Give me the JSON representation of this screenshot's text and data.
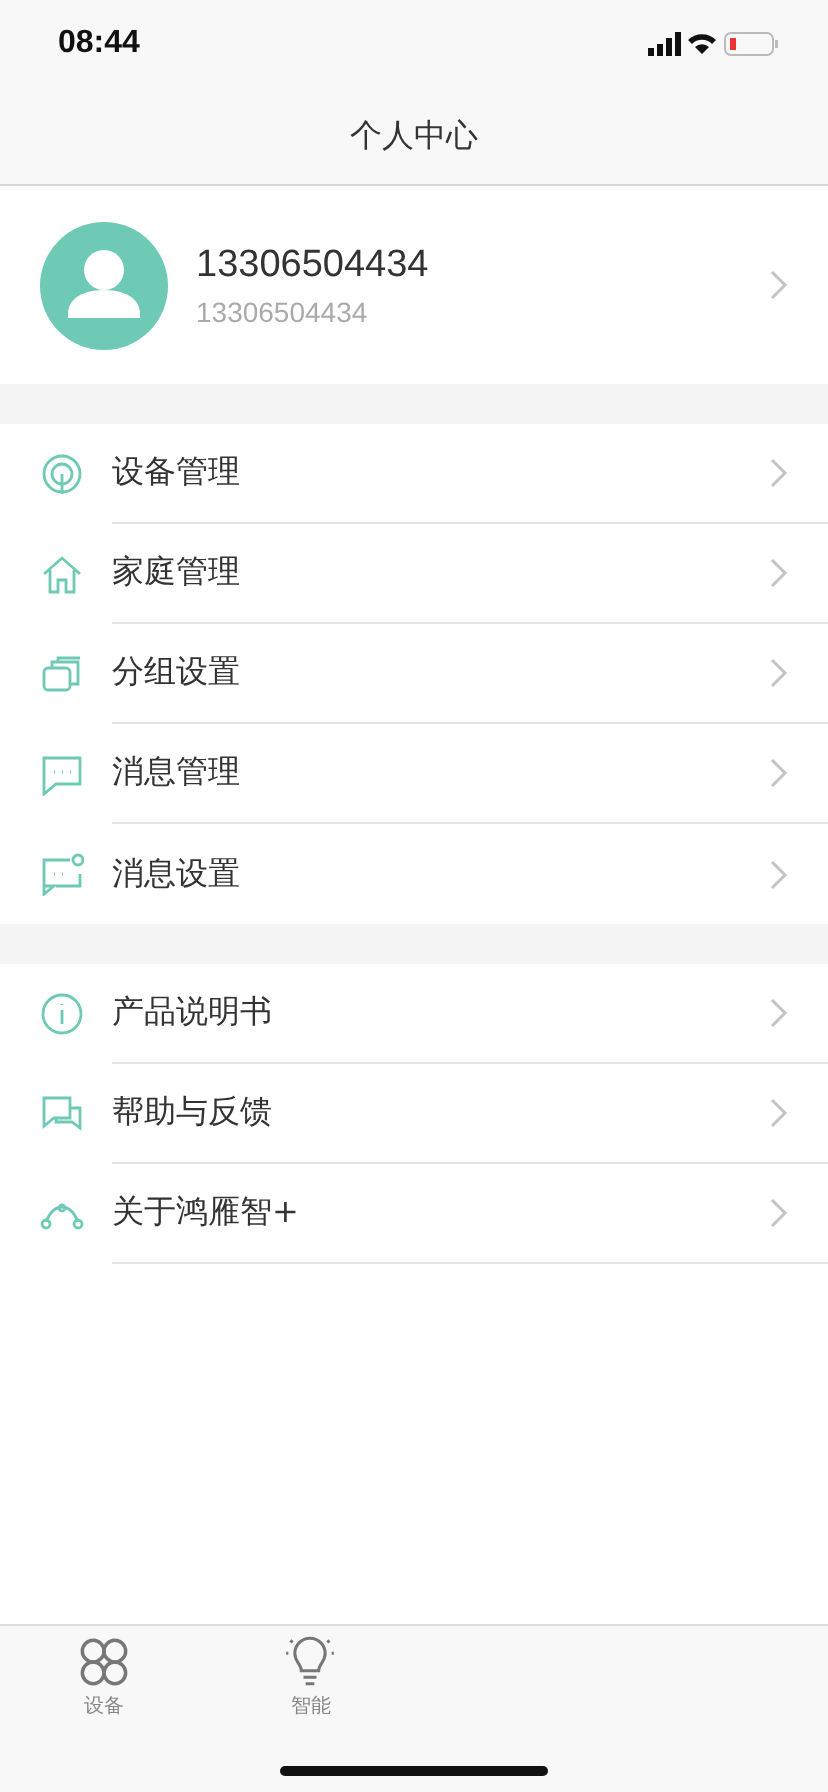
{
  "status_bar": {
    "time": "08:44"
  },
  "nav_bar": {
    "title": "个人中心"
  },
  "profile": {
    "name": "13306504434",
    "account": "13306504434"
  },
  "menu_groups": [
    {
      "items": [
        {
          "label": "设备管理"
        },
        {
          "label": "家庭管理"
        },
        {
          "label": "分组设置"
        },
        {
          "label": "消息管理"
        },
        {
          "label": "消息设置"
        }
      ]
    },
    {
      "items": [
        {
          "label": "产品说明书"
        },
        {
          "label": "帮助与反馈"
        },
        {
          "label": "关于鸿雁智+"
        }
      ]
    }
  ],
  "tab_bar": [
    {
      "label": "设备",
      "selected": false
    },
    {
      "label": "智能",
      "selected": false
    }
  ]
}
